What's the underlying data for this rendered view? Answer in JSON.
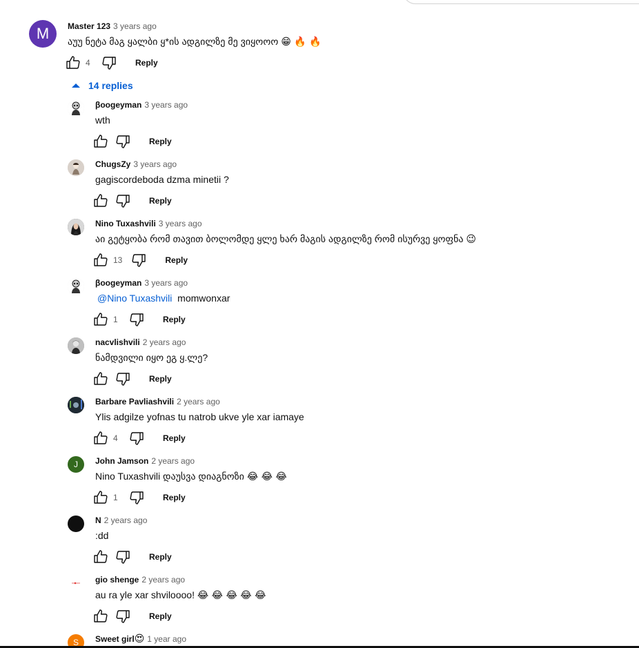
{
  "accent_color": "#065fd4",
  "main_comment": {
    "avatar_letter": "M",
    "avatar_color": "#5e35b1",
    "author": "Master 123",
    "time": "3 years ago",
    "text": "აუუ ნეტა მაგ ყალბი ყ*ის ადგილზე მე ვიყოოო",
    "emojis": "😁 🔥 🔥",
    "likes": "4",
    "reply_label": "Reply"
  },
  "replies_toggle": {
    "label": "14 replies",
    "icon": "caret-up-icon"
  },
  "replies": [
    {
      "author": "βoogeyman",
      "time": "3 years ago",
      "text": "wth",
      "emojis": "",
      "mention": "",
      "likes": "",
      "reply_label": "Reply",
      "avatar": "skull-figure",
      "avatar_color": "#e0e0e0"
    },
    {
      "author": "ChugsZy",
      "time": "3 years ago",
      "text": "gagiscordeboda dzma minetii ?",
      "emojis": "",
      "mention": "",
      "likes": "",
      "reply_label": "Reply",
      "avatar": "anime-figure",
      "avatar_color": "#d7cfc8"
    },
    {
      "author": "Nino Tuxashvili",
      "time": "3 years ago",
      "text": "აი გეტყობა რომ თავით ბოლომდე ყლე ხარ მაგის ადგილზე რომ ისურვე ყოფნა",
      "emojis": "😉",
      "mention": "",
      "likes": "13",
      "reply_label": "Reply",
      "avatar": "woman-portrait",
      "avatar_color": "#3a3a3a"
    },
    {
      "author": "βoogeyman",
      "time": "3 years ago",
      "text": "momwonxar",
      "emojis": "",
      "mention": "@Nino Tuxashvili",
      "likes": "1",
      "reply_label": "Reply",
      "avatar": "skull-figure",
      "avatar_color": "#e0e0e0"
    },
    {
      "author": "nacvlishvili",
      "time": "2 years ago",
      "text": "ნამდვილი იყო ეგ ყ.ლე?",
      "emojis": "",
      "mention": "",
      "likes": "",
      "reply_label": "Reply",
      "avatar": "bw-portrait",
      "avatar_color": "#8a8a8a"
    },
    {
      "author": "Barbare Pavliashvili",
      "time": "2 years ago",
      "text": "Ylis adgilze yofnas tu natrob ukve yle xar iamaye",
      "emojis": "",
      "mention": "",
      "likes": "4",
      "reply_label": "Reply",
      "avatar": "dark-scene",
      "avatar_color": "#1f2a33"
    },
    {
      "author": "John Jamson",
      "time": "2 years ago",
      "text": "Nino Tuxashvili დაუსვა დიაგნოზი",
      "emojis": "😂 😂 😂",
      "mention": "",
      "likes": "1",
      "reply_label": "Reply",
      "avatar": "letter",
      "avatar_letter": "J",
      "avatar_color": "#33691e"
    },
    {
      "author": "N",
      "time": "2 years ago",
      "text": ":dd",
      "emojis": "",
      "mention": "",
      "likes": "",
      "reply_label": "Reply",
      "avatar": "black-circle",
      "avatar_color": "#0f0f0f"
    },
    {
      "author": "gio shenge",
      "time": "2 years ago",
      "text": "au ra yle xar shviloooo!",
      "emojis": "😂 😂 😂 😂 😂",
      "mention": "",
      "likes": "",
      "reply_label": "Reply",
      "avatar": "small-logo",
      "avatar_color": "#ffffff"
    },
    {
      "author": "Sweet girl",
      "author_emoji": "😍",
      "time": "1 year ago",
      "text": "",
      "emojis": "",
      "mention": "",
      "likes": "",
      "reply_label": "",
      "avatar": "letter",
      "avatar_letter": "S",
      "avatar_color": "#f57c00"
    }
  ]
}
